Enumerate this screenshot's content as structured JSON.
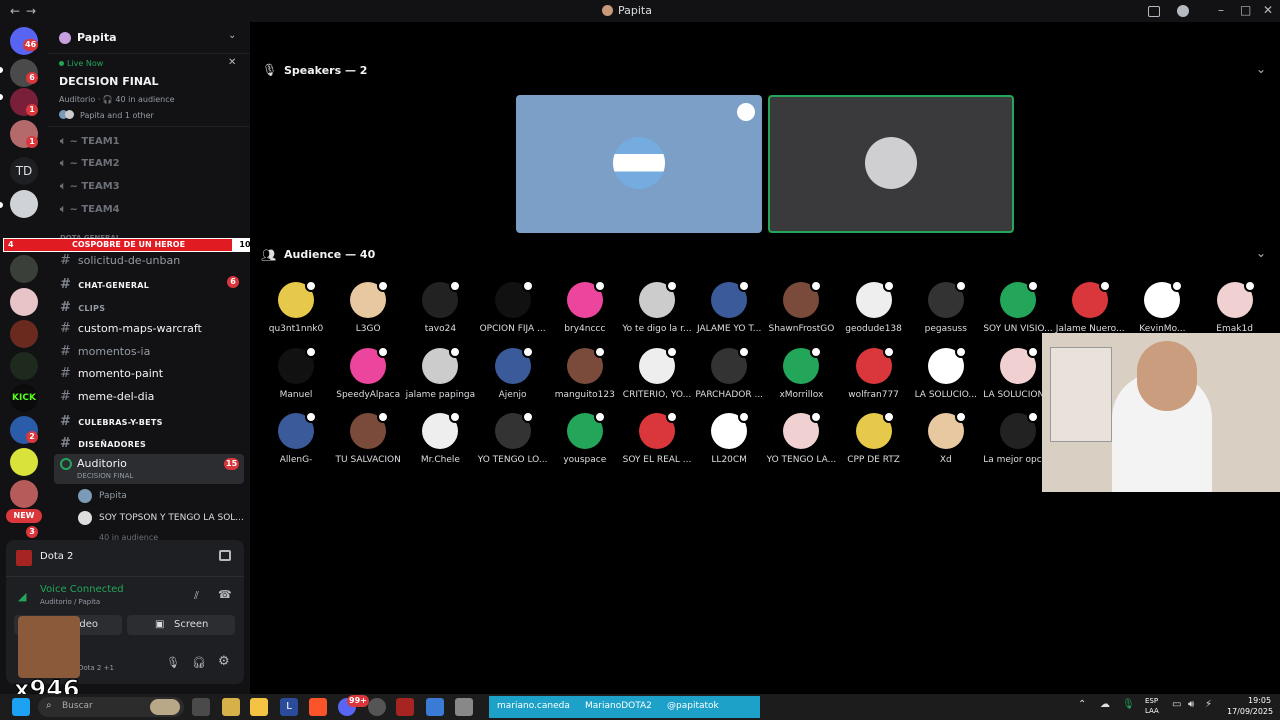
{
  "titlebar": {
    "title": "Papita",
    "back": "←",
    "forward": "→"
  },
  "server_rail": {
    "badges": [
      "46",
      "6",
      "1",
      "1",
      "2",
      "3"
    ],
    "td_label": "TD",
    "new_label": "NEW"
  },
  "sidebar": {
    "server_name": "Papita",
    "stage": {
      "live_label": "Live Now",
      "title": "DECISION FINAL",
      "meta": "Auditorio · 🎧 40 in audience",
      "speakers": "Papita and 1 other"
    },
    "voice_channels": [
      "TEAM1",
      "TEAM2",
      "TEAM3",
      "TEAM4"
    ],
    "category": "DOTA GENERAL",
    "overlay": {
      "left": "4",
      "text": "COSPOBRE DE UN HEROE",
      "right": "10"
    },
    "channels": [
      {
        "label": "solicitud-de-unban"
      },
      {
        "label": "CHAT-GENERAL",
        "badge": "6"
      },
      {
        "label": "CLIPS"
      },
      {
        "label": "custom-maps-warcraft"
      },
      {
        "label": "momentos-ia"
      },
      {
        "label": "momento-paint"
      },
      {
        "label": "meme-del-dia"
      },
      {
        "label": "CULEBRAS-Y-BETS"
      },
      {
        "label": "DISEÑADORES"
      }
    ],
    "stage_channel": {
      "label": "Auditorio",
      "sub": "DECISION FINAL",
      "badge": "15"
    },
    "stage_members": [
      "Papita",
      "SOY TOPSON Y TENGO LA SOL..."
    ],
    "audience_count": "40 in audience"
  },
  "panel": {
    "game": "Dota 2",
    "voice_status": "Voice Connected",
    "voice_location": "Auditorio / Papita",
    "video_label": "Video",
    "screen_label": "Screen",
    "user_sub": "Dota 2 +1",
    "overlay_text": "x946"
  },
  "main": {
    "speakers_title": "Speakers — 2",
    "audience_title": "Audience — 40",
    "audience_rows": [
      [
        "qu3nt1nnk0",
        "L3GO",
        "tavo24",
        "OPCION FIJA ...",
        "bry4nccc",
        "Yo te digo la r...",
        "JALAME YO T...",
        "ShawnFrostGO",
        "geodude138",
        "pegasuss",
        "SOY UN VISIO...",
        "Jalame Ñuero...",
        "KevinMo...",
        "Emak1d"
      ],
      [
        "Manuel",
        "SpeedyAlpaca",
        "jalame papinga",
        "Ajenjo",
        "manguito123",
        "CRITERIO, YO...",
        "PARCHADOR ...",
        "xMorrillox",
        "wolfran777",
        "LA SOLUCIO...",
        "LA SOLUCION..."
      ],
      [
        "AllenG-",
        "TU SALVACION",
        "Mr.Chele",
        "YO TENGO LO...",
        "youspace",
        "SOY EL REAL ...",
        "LL20CM",
        "YO TENGO LA...",
        "CPP DE RTZ",
        "Xd",
        "La mejor opci..."
      ]
    ]
  },
  "taskbar": {
    "search": "Buscar",
    "banner": [
      "mariano.caneda",
      "MarianoDOTA2",
      "@papitatok"
    ],
    "lang": "ESP",
    "region": "LAA",
    "time": "19:05",
    "date": "17/09/2025",
    "discord_badge": "99+"
  },
  "colors": {
    "accent": "#23a55a",
    "danger": "#da373c",
    "blurple": "#5865f2",
    "banner": "#1da1c8"
  }
}
